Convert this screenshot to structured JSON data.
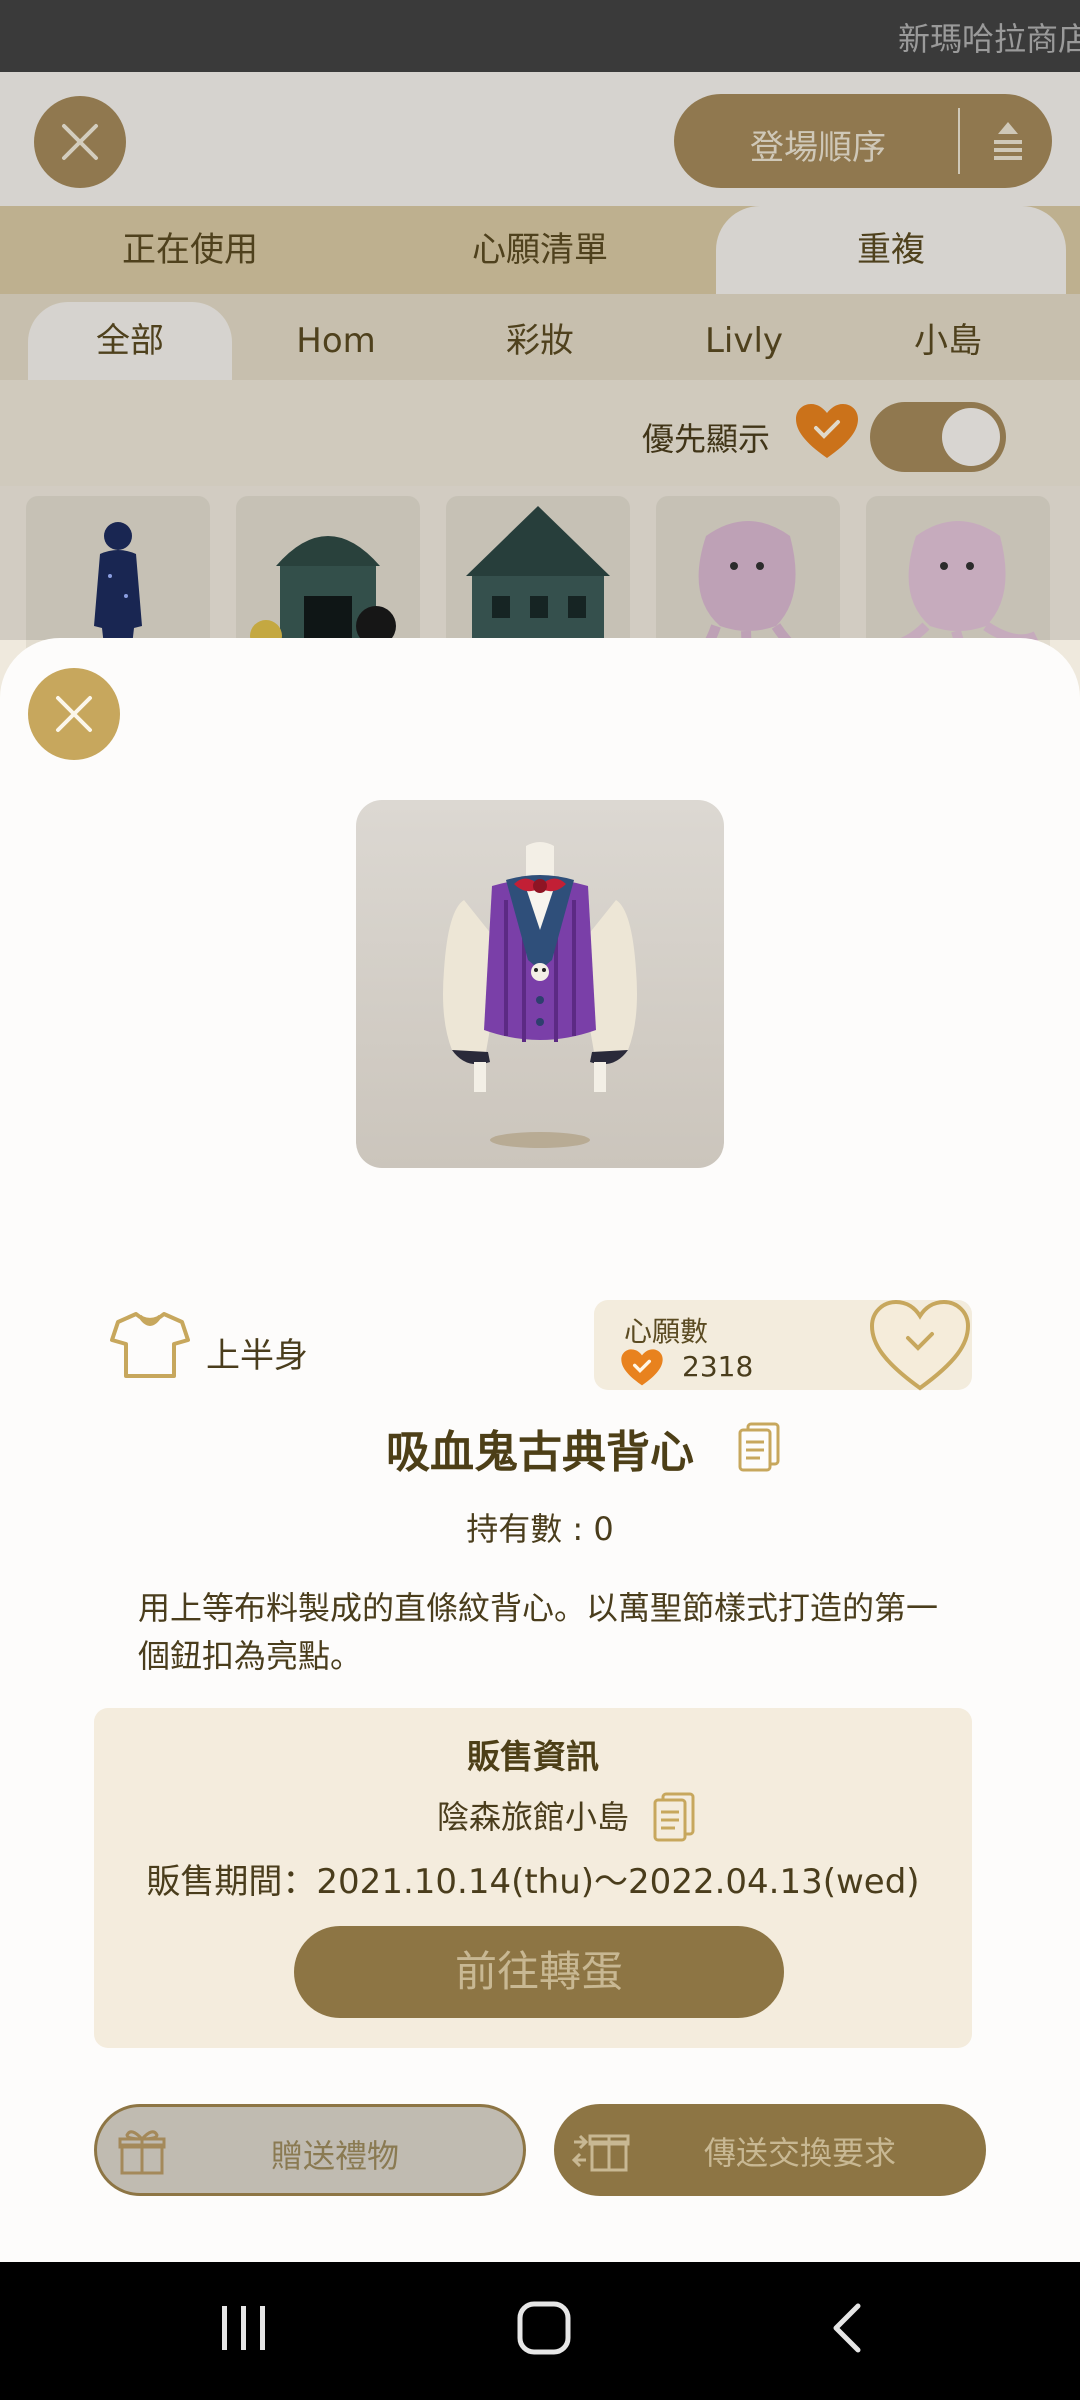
{
  "status_bar": {
    "marquee": "新瑪哈拉商店"
  },
  "header": {
    "sort_label": "登場順序"
  },
  "tabs_primary": [
    {
      "label": "正在使用"
    },
    {
      "label": "心願清單"
    },
    {
      "label": "重複",
      "active": true
    }
  ],
  "tabs_secondary": [
    {
      "label": "全部",
      "active": true
    },
    {
      "label": "Hom"
    },
    {
      "label": "彩妝"
    },
    {
      "label": "Livly"
    },
    {
      "label": "小島"
    }
  ],
  "filter": {
    "label": "優先顯示",
    "toggle_on": true
  },
  "item": {
    "category": "上半身",
    "wish_label": "心願數",
    "wish_count": "2318",
    "name": "吸血鬼古典背心",
    "owned": "持有數 : 0",
    "description": "用上等布料製成的直條紋背心。以萬聖節樣式打造的第一個鈕扣為亮點。"
  },
  "sale_info": {
    "heading": "販售資訊",
    "island": "陰森旅館小島",
    "period": "販售期間：2021.10.14(thu)～2022.04.13(wed)",
    "gacha_button": "前往轉蛋"
  },
  "actions": {
    "gift": "贈送禮物",
    "trade": "傳送交換要求"
  },
  "colors": {
    "gold": "#a4895a",
    "dark_gold": "#8d7544",
    "heart_orange": "#e8821e"
  }
}
